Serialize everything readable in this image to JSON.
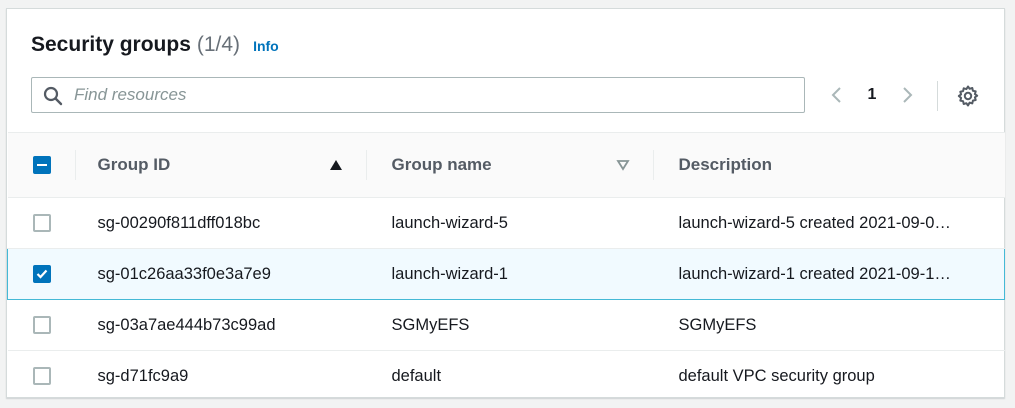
{
  "header": {
    "title": "Security groups",
    "count": "(1/4)",
    "info_label": "Info"
  },
  "search": {
    "placeholder": "Find resources",
    "value": ""
  },
  "pagination": {
    "current_page": "1"
  },
  "table": {
    "columns": {
      "group_id": "Group ID",
      "group_name": "Group name",
      "description": "Description"
    },
    "rows": [
      {
        "group_id": "sg-00290f811dff018bc",
        "group_name": "launch-wizard-5",
        "description": "launch-wizard-5 created 2021-09-0…",
        "selected": false
      },
      {
        "group_id": "sg-01c26aa33f0e3a7e9",
        "group_name": "launch-wizard-1",
        "description": "launch-wizard-1 created 2021-09-1…",
        "selected": true
      },
      {
        "group_id": "sg-03a7ae444b73c99ad",
        "group_name": "SGMyEFS",
        "description": "SGMyEFS",
        "selected": false
      },
      {
        "group_id": "sg-d71fc9a9",
        "group_name": "default",
        "description": "default VPC security group",
        "selected": false
      }
    ]
  },
  "icons": {
    "search": "search-icon",
    "prev": "chevron-left-icon",
    "next": "chevron-right-icon",
    "settings": "gear-icon",
    "sort_asc": "sort-ascending-icon",
    "sort_none": "sort-descending-outline-icon"
  },
  "colors": {
    "accent": "#0073bb",
    "selected_row_bg": "#f1faff",
    "selected_row_border": "#44b9d6"
  }
}
